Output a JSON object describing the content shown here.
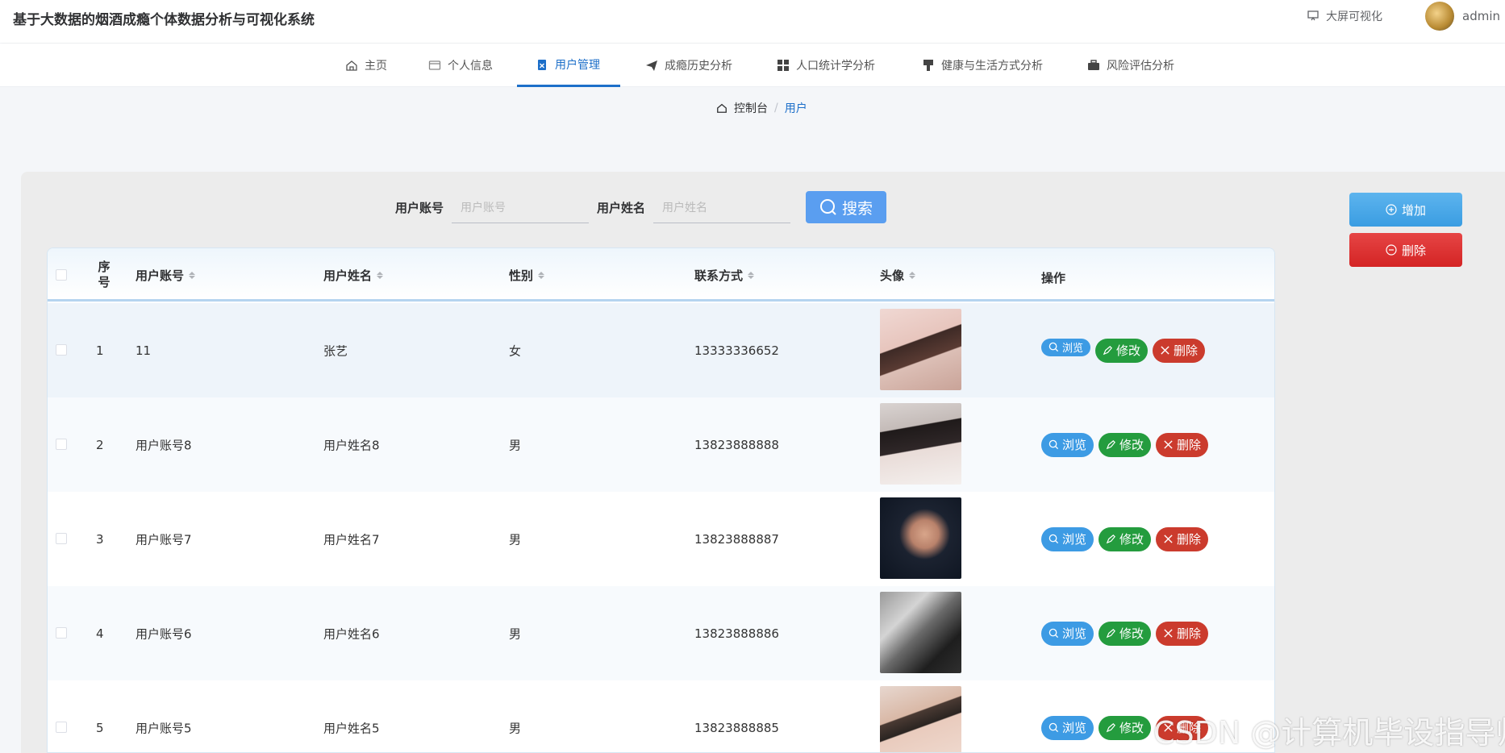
{
  "header": {
    "app_title": "基于大数据的烟酒成瘾个体数据分析与可视化系统",
    "bigscreen_label": "大屏可视化",
    "username": "admin"
  },
  "nav": {
    "items": [
      {
        "label": "主页",
        "icon": "home-icon"
      },
      {
        "label": "个人信息",
        "icon": "wallet-icon"
      },
      {
        "label": "用户管理",
        "icon": "clipboard-icon",
        "active": true
      },
      {
        "label": "成瘾历史分析",
        "icon": "send-icon"
      },
      {
        "label": "人口统计学分析",
        "icon": "grid-icon"
      },
      {
        "label": "健康与生活方式分析",
        "icon": "brush-icon"
      },
      {
        "label": "风险评估分析",
        "icon": "briefcase-icon"
      }
    ]
  },
  "breadcrumb": {
    "home": "控制台",
    "current": "用户"
  },
  "search": {
    "account_label": "用户账号",
    "account_placeholder": "用户账号",
    "name_label": "用户姓名",
    "name_placeholder": "用户姓名",
    "button": "搜索"
  },
  "actions": {
    "add": "增加",
    "delete": "删除"
  },
  "table": {
    "columns": [
      "序号",
      "用户账号",
      "用户姓名",
      "性别",
      "联系方式",
      "头像",
      "操作"
    ],
    "rows": [
      {
        "index": "1",
        "account": "11",
        "name": "张艺",
        "gender": "女",
        "phone": "13333336652"
      },
      {
        "index": "2",
        "account": "用户账号8",
        "name": "用户姓名8",
        "gender": "男",
        "phone": "13823888888"
      },
      {
        "index": "3",
        "account": "用户账号7",
        "name": "用户姓名7",
        "gender": "男",
        "phone": "13823888887"
      },
      {
        "index": "4",
        "account": "用户账号6",
        "name": "用户姓名6",
        "gender": "男",
        "phone": "13823888886"
      },
      {
        "index": "5",
        "account": "用户账号5",
        "name": "用户姓名5",
        "gender": "男",
        "phone": "13823888885"
      }
    ],
    "op_labels": {
      "view": "浏览",
      "edit": "修改",
      "delete": "删除"
    }
  },
  "watermark": "CSDN @计算机毕设指导师"
}
